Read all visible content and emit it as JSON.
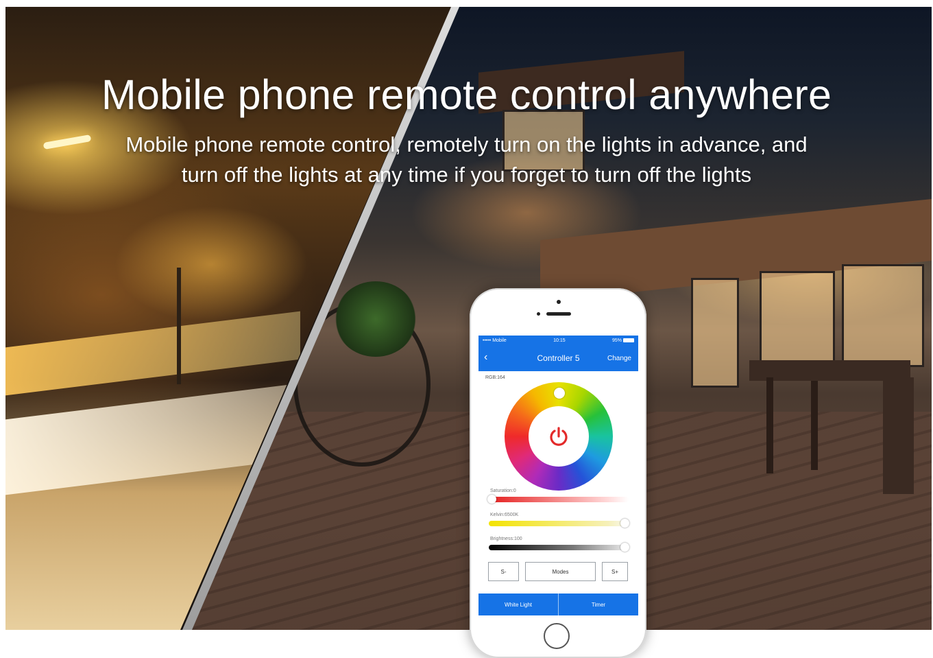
{
  "hero": {
    "title": "Mobile phone remote control anywhere",
    "subtitle_line1": "Mobile phone remote control, remotely turn on the lights in advance, and",
    "subtitle_line2": "turn off the lights at any time if you forget to turn off the lights"
  },
  "phone": {
    "status": {
      "carrier": "••••• Mobile",
      "time": "10:15",
      "battery": "95%"
    },
    "nav": {
      "back": "‹",
      "title": "Controller 5",
      "action": "Change"
    },
    "rgb_label": "RGB:164",
    "sliders": [
      {
        "label": "Saturation:0",
        "value": 0
      },
      {
        "label": "Kelvin:6500K",
        "value": 1
      },
      {
        "label": "Brightness:100",
        "value": 1
      }
    ],
    "buttons": {
      "speed_down": "S-",
      "modes": "Modes",
      "speed_up": "S+"
    },
    "tabs": {
      "white_light": "White Light",
      "timer": "Timer"
    },
    "icons": [
      "power-icon",
      "back-icon",
      "color-wheel"
    ]
  },
  "colors": {
    "accent": "#1673e6"
  }
}
